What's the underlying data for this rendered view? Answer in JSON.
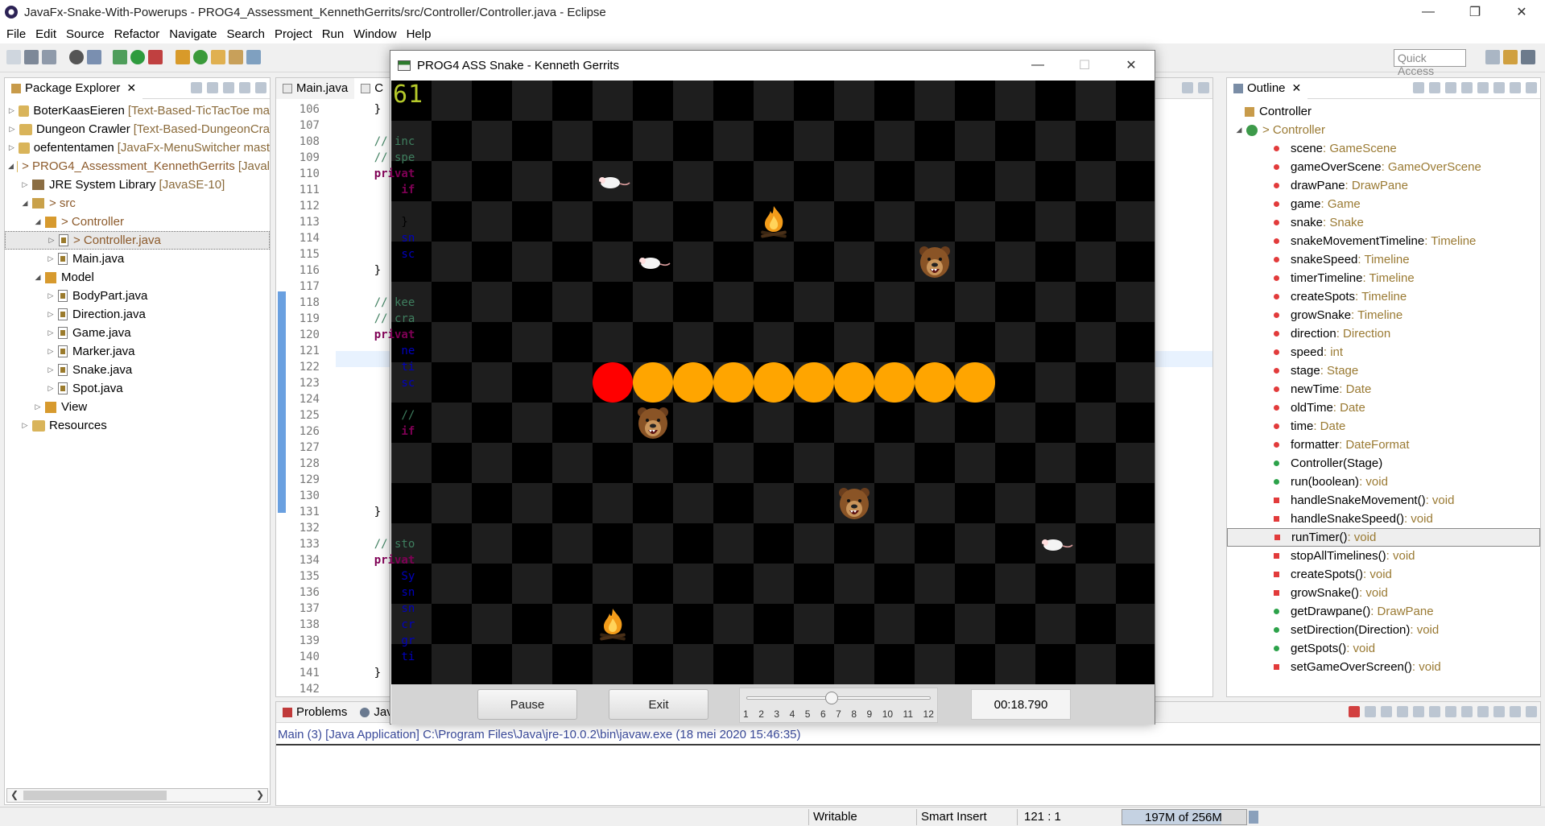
{
  "window": {
    "title": "JavaFx-Snake-With-Powerups - PROG4_Assessment_KennethGerrits/src/Controller/Controller.java - Eclipse",
    "minimize": "—",
    "maximize": "❐",
    "close": "✕"
  },
  "menu": [
    "File",
    "Edit",
    "Source",
    "Refactor",
    "Navigate",
    "Search",
    "Project",
    "Run",
    "Window",
    "Help"
  ],
  "toolbar": {
    "quick_access": "Quick Access"
  },
  "package_explorer": {
    "tab_label": "Package Explorer",
    "items": [
      {
        "indent": 0,
        "twist": "▷",
        "icon": "project",
        "label": "BoterKaasEieren",
        "extra": "[Text-Based-TicTacToe ma"
      },
      {
        "indent": 0,
        "twist": "▷",
        "icon": "project",
        "label": "Dungeon Crawler",
        "extra": "[Text-Based-DungeonCra"
      },
      {
        "indent": 0,
        "twist": "▷",
        "icon": "project",
        "label": "oefententamen",
        "extra": "[JavaFx-MenuSwitcher mast"
      },
      {
        "indent": 0,
        "twist": "◢",
        "icon": "project",
        "label": "> PROG4_Assessment_KennethGerrits",
        "extra": "[Javal"
      },
      {
        "indent": 1,
        "twist": "▷",
        "icon": "library",
        "label": "JRE System Library",
        "extra": "[JavaSE-10]"
      },
      {
        "indent": 1,
        "twist": "◢",
        "icon": "src",
        "label": "> src",
        "extra": ""
      },
      {
        "indent": 2,
        "twist": "◢",
        "icon": "package",
        "label": "> Controller",
        "extra": ""
      },
      {
        "indent": 3,
        "twist": "▷",
        "icon": "file",
        "label": "> Controller.java",
        "extra": "",
        "selected": true
      },
      {
        "indent": 3,
        "twist": "▷",
        "icon": "file",
        "label": "Main.java",
        "extra": ""
      },
      {
        "indent": 2,
        "twist": "◢",
        "icon": "package",
        "label": "Model",
        "extra": ""
      },
      {
        "indent": 3,
        "twist": "▷",
        "icon": "file",
        "label": "BodyPart.java",
        "extra": ""
      },
      {
        "indent": 3,
        "twist": "▷",
        "icon": "file",
        "label": "Direction.java",
        "extra": ""
      },
      {
        "indent": 3,
        "twist": "▷",
        "icon": "file",
        "label": "Game.java",
        "extra": ""
      },
      {
        "indent": 3,
        "twist": "▷",
        "icon": "file",
        "label": "Marker.java",
        "extra": ""
      },
      {
        "indent": 3,
        "twist": "▷",
        "icon": "file",
        "label": "Snake.java",
        "extra": ""
      },
      {
        "indent": 3,
        "twist": "▷",
        "icon": "file",
        "label": "Spot.java",
        "extra": ""
      },
      {
        "indent": 2,
        "twist": "▷",
        "icon": "package",
        "label": "View",
        "extra": ""
      },
      {
        "indent": 1,
        "twist": "▷",
        "icon": "project",
        "label": "Resources",
        "extra": ""
      }
    ]
  },
  "editor": {
    "tabs": [
      "Main.java",
      "C"
    ],
    "line_numbers": [
      "106",
      "107",
      "108",
      "109",
      "110",
      "111",
      "112",
      "113",
      "114",
      "115",
      "116",
      "117",
      "118",
      "119",
      "120",
      "121",
      "122",
      "123",
      "124",
      "125",
      "126",
      "127",
      "128",
      "129",
      "130",
      "131",
      "132",
      "133",
      "134",
      "135",
      "136",
      "137",
      "138",
      "139",
      "140",
      "141",
      "142"
    ],
    "code": [
      {
        "n": 0,
        "parts": [
          [
            "pl",
            "    }"
          ]
        ]
      },
      {
        "n": 2,
        "parts": [
          [
            "cm",
            "    // inc"
          ]
        ]
      },
      {
        "n": 3,
        "parts": [
          [
            "cm",
            "    // spe"
          ]
        ]
      },
      {
        "n": 4,
        "parts": [
          [
            "kw",
            "    privat"
          ]
        ]
      },
      {
        "n": 5,
        "parts": [
          [
            "kw",
            "        if"
          ]
        ]
      },
      {
        "n": 7,
        "parts": [
          [
            "pl",
            "        }"
          ]
        ]
      },
      {
        "n": 8,
        "parts": [
          [
            "fld",
            "        sn"
          ]
        ]
      },
      {
        "n": 9,
        "parts": [
          [
            "fld",
            "        sc"
          ]
        ]
      },
      {
        "n": 10,
        "parts": [
          [
            "pl",
            "    }"
          ]
        ]
      },
      {
        "n": 12,
        "parts": [
          [
            "cm",
            "    // kee"
          ]
        ]
      },
      {
        "n": 13,
        "parts": [
          [
            "cm",
            "    // cra"
          ]
        ]
      },
      {
        "n": 14,
        "parts": [
          [
            "kw",
            "    privat"
          ]
        ]
      },
      {
        "n": 15,
        "parts": [
          [
            "fld",
            "        ne"
          ]
        ]
      },
      {
        "n": 16,
        "parts": [
          [
            "fld",
            "        ti"
          ]
        ]
      },
      {
        "n": 17,
        "parts": [
          [
            "fld",
            "        sc"
          ]
        ]
      },
      {
        "n": 19,
        "parts": [
          [
            "cm",
            "        //"
          ]
        ]
      },
      {
        "n": 20,
        "parts": [
          [
            "kw",
            "        if"
          ]
        ]
      },
      {
        "n": 24,
        "parts": [
          [
            "pl",
            "        }"
          ]
        ]
      },
      {
        "n": 25,
        "parts": [
          [
            "pl",
            "    }"
          ]
        ]
      },
      {
        "n": 27,
        "parts": [
          [
            "cm",
            "    // sto"
          ]
        ]
      },
      {
        "n": 28,
        "parts": [
          [
            "kw",
            "    privat"
          ]
        ]
      },
      {
        "n": 29,
        "parts": [
          [
            "fld",
            "        Sy"
          ]
        ]
      },
      {
        "n": 30,
        "parts": [
          [
            "fld",
            "        sn"
          ]
        ]
      },
      {
        "n": 31,
        "parts": [
          [
            "fld",
            "        sn"
          ]
        ]
      },
      {
        "n": 32,
        "parts": [
          [
            "fld",
            "        cr"
          ]
        ]
      },
      {
        "n": 33,
        "parts": [
          [
            "fld",
            "        gr"
          ]
        ]
      },
      {
        "n": 34,
        "parts": [
          [
            "fld",
            "        ti"
          ]
        ]
      },
      {
        "n": 35,
        "parts": [
          [
            "pl",
            "    }"
          ]
        ]
      }
    ]
  },
  "outline": {
    "tab_label": "Outline",
    "root": "Controller",
    "class": "> Controller",
    "members": [
      {
        "kind": "field",
        "name": "scene",
        "type": " : GameScene"
      },
      {
        "kind": "field",
        "name": "gameOverScene",
        "type": " : GameOverScene"
      },
      {
        "kind": "field",
        "name": "drawPane",
        "type": " : DrawPane"
      },
      {
        "kind": "field",
        "name": "game",
        "type": " : Game"
      },
      {
        "kind": "field",
        "name": "snake",
        "type": " : Snake"
      },
      {
        "kind": "field",
        "name": "snakeMovementTimeline",
        "type": " : Timeline"
      },
      {
        "kind": "field",
        "name": "snakeSpeed",
        "type": " : Timeline"
      },
      {
        "kind": "field",
        "name": "timerTimeline",
        "type": " : Timeline"
      },
      {
        "kind": "field",
        "name": "createSpots",
        "type": " : Timeline"
      },
      {
        "kind": "field",
        "name": "growSnake",
        "type": " : Timeline"
      },
      {
        "kind": "field",
        "name": "direction",
        "type": " : Direction"
      },
      {
        "kind": "field",
        "name": "speed",
        "type": " : int"
      },
      {
        "kind": "field",
        "name": "stage",
        "type": " : Stage"
      },
      {
        "kind": "field",
        "name": "newTime",
        "type": " : Date"
      },
      {
        "kind": "field",
        "name": "oldTime",
        "type": " : Date"
      },
      {
        "kind": "field",
        "name": "time",
        "type": " : Date"
      },
      {
        "kind": "field",
        "name": "formatter",
        "type": " : DateFormat"
      },
      {
        "kind": "public",
        "name": "Controller(Stage)",
        "type": ""
      },
      {
        "kind": "public",
        "name": "run(boolean)",
        "type": " : void"
      },
      {
        "kind": "private",
        "name": "handleSnakeMovement()",
        "type": " : void"
      },
      {
        "kind": "private",
        "name": "handleSnakeSpeed()",
        "type": " : void"
      },
      {
        "kind": "private",
        "name": "runTimer()",
        "type": " : void",
        "selected": true
      },
      {
        "kind": "private",
        "name": "stopAllTimelines()",
        "type": " : void"
      },
      {
        "kind": "private",
        "name": "createSpots()",
        "type": " : void"
      },
      {
        "kind": "private",
        "name": "growSnake()",
        "type": " : void"
      },
      {
        "kind": "public",
        "name": "getDrawpane()",
        "type": " : DrawPane"
      },
      {
        "kind": "public",
        "name": "setDirection(Direction)",
        "type": " : void"
      },
      {
        "kind": "public",
        "name": "getSpots()",
        "type": " : void"
      },
      {
        "kind": "private",
        "name": "setGameOverScreen()",
        "type": " : void"
      }
    ]
  },
  "console": {
    "tabs": [
      "Problems",
      "Java"
    ],
    "line": "Main (3) [Java Application] C:\\Program Files\\Java\\jre-10.0.2\\bin\\javaw.exe (18 mei 2020 15:46:35)"
  },
  "status": {
    "writable": "Writable",
    "insert": "Smart Insert",
    "position": "121 : 1",
    "heap": "197M of 256M"
  },
  "game": {
    "title": "PROG4 ASS Snake - Kenneth Gerrits",
    "score": "61",
    "pause_label": "Pause",
    "exit_label": "Exit",
    "slider_ticks": [
      "1",
      "2",
      "3",
      "4",
      "5",
      "6",
      "7",
      "8",
      "9",
      "10",
      "11",
      "12"
    ],
    "slider_value": 6,
    "timer": "00:18.790",
    "colors": {
      "head": "#ff0000",
      "body": "#ffa500",
      "dark": "#000000",
      "light": "#1e1e1e"
    },
    "grid": {
      "cols": 19,
      "rows": 15
    },
    "snake": {
      "head": [
        5,
        7
      ],
      "body": [
        [
          6,
          7
        ],
        [
          7,
          7
        ],
        [
          8,
          7
        ],
        [
          9,
          7
        ],
        [
          10,
          7
        ],
        [
          11,
          7
        ],
        [
          12,
          7
        ],
        [
          13,
          7
        ],
        [
          14,
          7
        ]
      ]
    },
    "mice": [
      [
        5,
        2
      ],
      [
        6,
        4
      ],
      [
        16,
        11
      ]
    ],
    "fires": [
      [
        9,
        3
      ],
      [
        5,
        13
      ]
    ],
    "bears": [
      [
        13,
        4
      ],
      [
        6,
        8
      ],
      [
        11,
        10
      ]
    ]
  }
}
